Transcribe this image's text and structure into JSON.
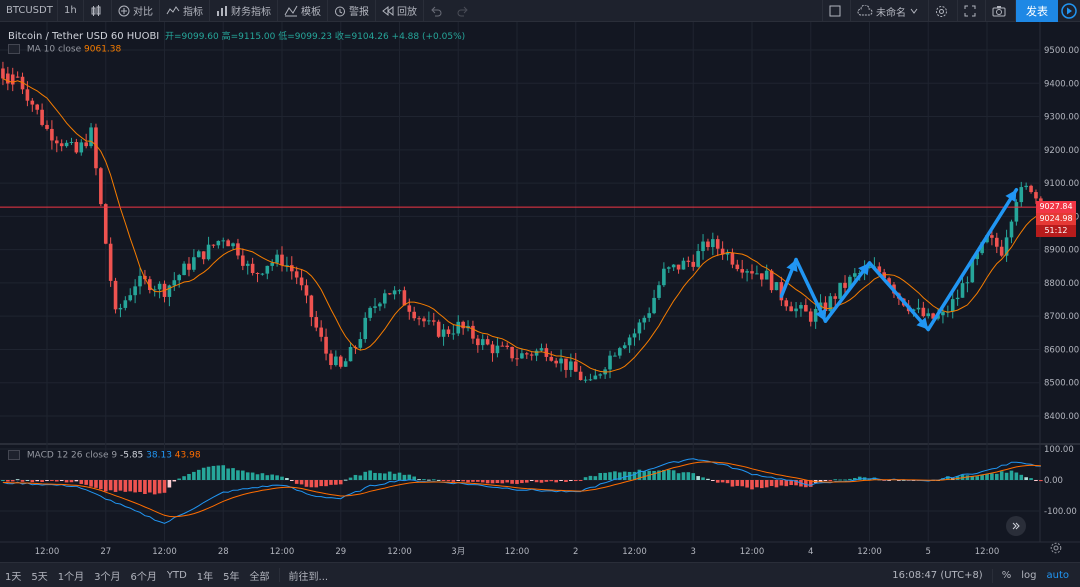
{
  "toolbar": {
    "symbol": "BTCUSDT",
    "interval": "1h",
    "compare": "对比",
    "indicators": "指标",
    "financials": "财务指标",
    "templates": "模板",
    "alert": "警报",
    "replay": "回放",
    "layout_name": "未命名",
    "publish": "发表"
  },
  "legend": {
    "title": "Bitcoin / Tether USD  60  HUOBI",
    "open": "开=9099.60",
    "high": "高=9115.00",
    "low": "低=9099.23",
    "close": "收=9104.26",
    "change": "+4.88 (+0.05%)",
    "ma_label": "MA 10 close",
    "ma_value": "9061.38",
    "macd_label": "MACD 12 26 close 9",
    "macd_v1": "-5.85",
    "macd_v2": "38.13",
    "macd_v3": "43.98"
  },
  "price_tags": {
    "last": "9027.84",
    "ma": "9024.98",
    "countdown": "51:12"
  },
  "bottombar": {
    "ranges": [
      "1天",
      "5天",
      "1个月",
      "3个月",
      "6个月",
      "YTD",
      "1年",
      "5年",
      "全部"
    ],
    "goto": "前往到...",
    "time": "16:08:47 (UTC+8)",
    "percent": "%",
    "log": "log",
    "auto": "auto"
  },
  "colors": {
    "up": "#26a69a",
    "down": "#ef5350",
    "ma": "#f57c00",
    "macd": "#2196f3",
    "signal": "#ff6d00",
    "pattern": "#2196f3",
    "bg": "#131722",
    "grid": "#1f2430",
    "text": "#b2b5be",
    "price_line": "#f23645"
  },
  "chart_data": [
    {
      "type": "candlestick",
      "title": "Bitcoin / Tether USD 60 HUOBI",
      "interval": "60",
      "yticks": [
        8400,
        8500,
        8600,
        8700,
        8800,
        8900,
        9000,
        9100,
        9200,
        9300,
        9400,
        9500
      ],
      "ylim": [
        8350,
        9560
      ],
      "xticks": [
        "12:00",
        "27",
        "12:00",
        "28",
        "12:00",
        "29",
        "12:00",
        "3月",
        "12:00",
        "2",
        "12:00",
        "3",
        "12:00",
        "4",
        "12:00",
        "5",
        "12:00"
      ],
      "last_price": 9027.84,
      "ma_last": 9024.98,
      "anchors": [
        [
          "02-26 06:00",
          9420
        ],
        [
          "02-26 12:00",
          9260
        ],
        [
          "02-26 18:00",
          9190
        ],
        [
          "02-26 21:00",
          9250
        ],
        [
          "02-27 00:00",
          8920
        ],
        [
          "02-27 02:00",
          8700
        ],
        [
          "02-27 06:00",
          8800
        ],
        [
          "02-27 09:00",
          8800
        ],
        [
          "02-27 12:00",
          8780
        ],
        [
          "02-27 18:00",
          8870
        ],
        [
          "02-27 21:00",
          8900
        ],
        [
          "02-28 00:00",
          8940
        ],
        [
          "02-28 03:00",
          8900
        ],
        [
          "02-28 06:00",
          8820
        ],
        [
          "02-28 09:00",
          8860
        ],
        [
          "02-28 12:00",
          8870
        ],
        [
          "02-28 15:00",
          8820
        ],
        [
          "02-28 18:00",
          8700
        ],
        [
          "02-28 21:00",
          8590
        ],
        [
          "02-29 00:00",
          8540
        ],
        [
          "02-29 03:00",
          8610
        ],
        [
          "02-29 06:00",
          8710
        ],
        [
          "02-29 09:00",
          8780
        ],
        [
          "02-29 12:00",
          8760
        ],
        [
          "02-29 18:00",
          8670
        ],
        [
          "02-29 21:00",
          8650
        ],
        [
          "03-01 00:00",
          8670
        ],
        [
          "03-01 06:00",
          8610
        ],
        [
          "03-01 12:00",
          8580
        ],
        [
          "03-01 18:00",
          8600
        ],
        [
          "03-02 00:00",
          8530
        ],
        [
          "03-02 03:00",
          8490
        ],
        [
          "03-02 06:00",
          8560
        ],
        [
          "03-02 09:00",
          8620
        ],
        [
          "03-02 12:00",
          8650
        ],
        [
          "03-02 15:00",
          8720
        ],
        [
          "03-02 18:00",
          8830
        ],
        [
          "03-03 00:00",
          8870
        ],
        [
          "03-03 03:00",
          8920
        ],
        [
          "03-03 06:00",
          8900
        ],
        [
          "03-03 09:00",
          8860
        ],
        [
          "03-03 12:00",
          8840
        ],
        [
          "03-03 15:00",
          8820
        ],
        [
          "03-03 18:00",
          8760
        ],
        [
          "03-03 21:00",
          8720
        ],
        [
          "03-04 00:00",
          8700
        ],
        [
          "03-04 03:00",
          8730
        ],
        [
          "03-04 06:00",
          8780
        ],
        [
          "03-04 09:00",
          8820
        ],
        [
          "03-04 12:00",
          8840
        ],
        [
          "03-04 15:00",
          8830
        ],
        [
          "03-04 18:00",
          8760
        ],
        [
          "03-04 21:00",
          8720
        ],
        [
          "03-05 00:00",
          8690
        ],
        [
          "03-05 03:00",
          8700
        ],
        [
          "03-05 06:00",
          8760
        ],
        [
          "03-05 09:00",
          8850
        ],
        [
          "03-05 12:00",
          8930
        ],
        [
          "03-05 15:00",
          8900
        ],
        [
          "03-05 18:00",
          9060
        ],
        [
          "03-05 21:00",
          9090
        ],
        [
          "03-05 23:00",
          9027
        ]
      ],
      "pattern_overlay": [
        [
          "03-03 18:00",
          8760
        ],
        [
          "03-03 21:00",
          8870
        ],
        [
          "03-04 03:00",
          8685
        ],
        [
          "03-04 12:00",
          8860
        ],
        [
          "03-05 00:00",
          8660
        ],
        [
          "03-05 18:00",
          9080
        ]
      ]
    },
    {
      "type": "macd",
      "title": "MACD 12 26 close 9",
      "yticks": [
        100,
        0,
        -100
      ],
      "ylim": [
        -140,
        110
      ],
      "values": {
        "histogram": -5.85,
        "macd": 38.13,
        "signal": 43.98
      },
      "anchors": [
        [
          "02-26 06:00",
          -10
        ],
        [
          "02-26 18:00",
          -20
        ],
        [
          "02-27 00:00",
          -60
        ],
        [
          "02-27 06:00",
          -100
        ],
        [
          "02-27 12:00",
          -140
        ],
        [
          "02-27 18:00",
          -90
        ],
        [
          "02-28 00:00",
          -40
        ],
        [
          "02-28 06:00",
          -25
        ],
        [
          "02-28 12:00",
          -15
        ],
        [
          "02-28 18:00",
          -50
        ],
        [
          "02-29 00:00",
          -60
        ],
        [
          "02-29 06:00",
          -20
        ],
        [
          "02-29 12:00",
          0
        ],
        [
          "03-01 00:00",
          -10
        ],
        [
          "03-01 12:00",
          -30
        ],
        [
          "03-02 00:00",
          -40
        ],
        [
          "03-02 12:00",
          20
        ],
        [
          "03-02 18:00",
          50
        ],
        [
          "03-03 00:00",
          70
        ],
        [
          "03-03 06:00",
          50
        ],
        [
          "03-03 12:00",
          20
        ],
        [
          "03-04 00:00",
          -15
        ],
        [
          "03-04 12:00",
          5
        ],
        [
          "03-05 00:00",
          -5
        ],
        [
          "03-05 12:00",
          30
        ],
        [
          "03-05 18:00",
          60
        ],
        [
          "03-05 23:00",
          45
        ]
      ]
    }
  ]
}
